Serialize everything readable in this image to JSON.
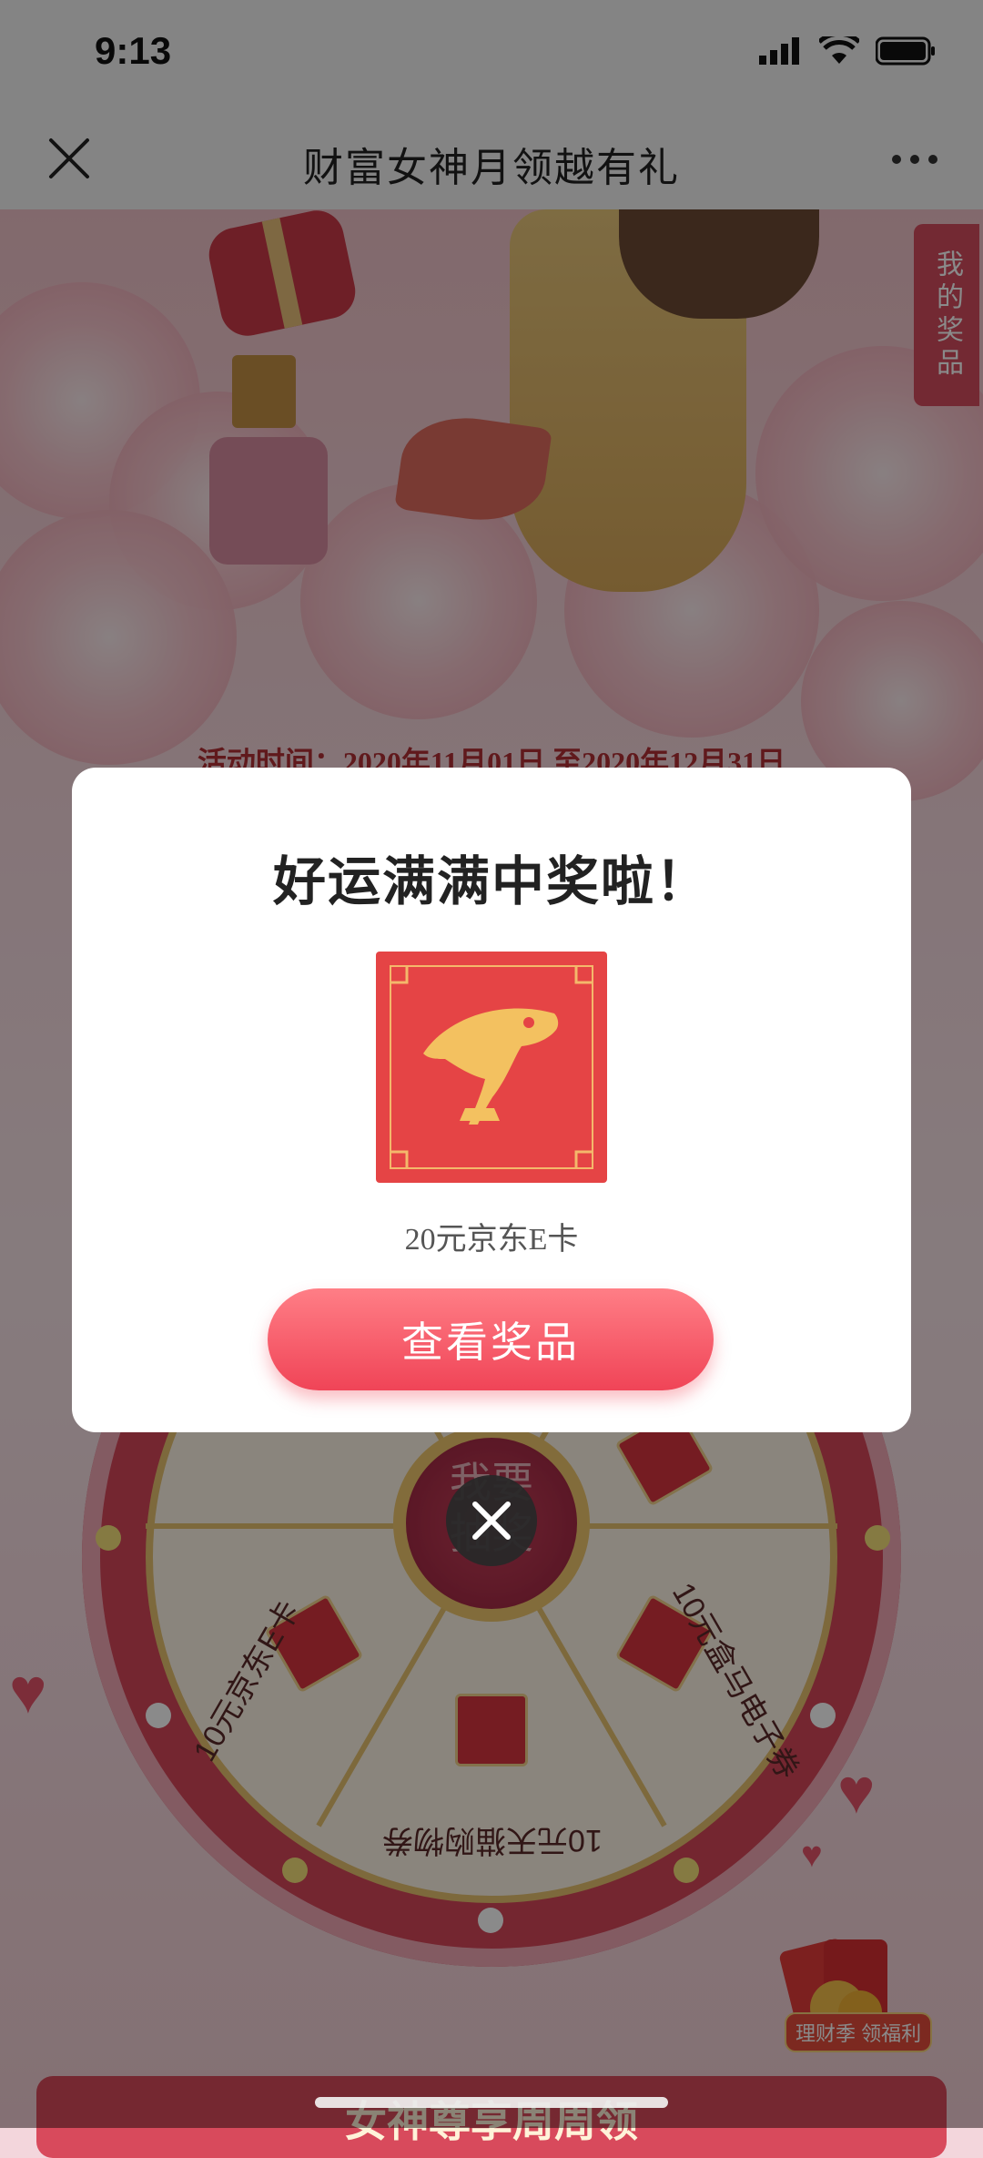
{
  "status_bar": {
    "time": "9:13"
  },
  "nav": {
    "title": "财富女神月领越有礼"
  },
  "page": {
    "my_prizes": "我的奖品",
    "activity_time": "活动时间：2020年11月01日 至2020年12月31日",
    "wheel": {
      "center_label": "我要\n抽奖",
      "labels": [
        "10元京东E卡",
        "10元天猫购物券",
        "10元盒马电子券"
      ]
    },
    "badge_label": "理财季 领福利",
    "bottom_title": "女神尊享周周领"
  },
  "modal": {
    "title": "好运满满中奖啦！",
    "prize_caption": "20元京东E卡",
    "view_button": "查看奖品"
  },
  "colors": {
    "accent": "#f04457",
    "prize_card": "#e54445",
    "brand_gold": "#f2c35a"
  }
}
